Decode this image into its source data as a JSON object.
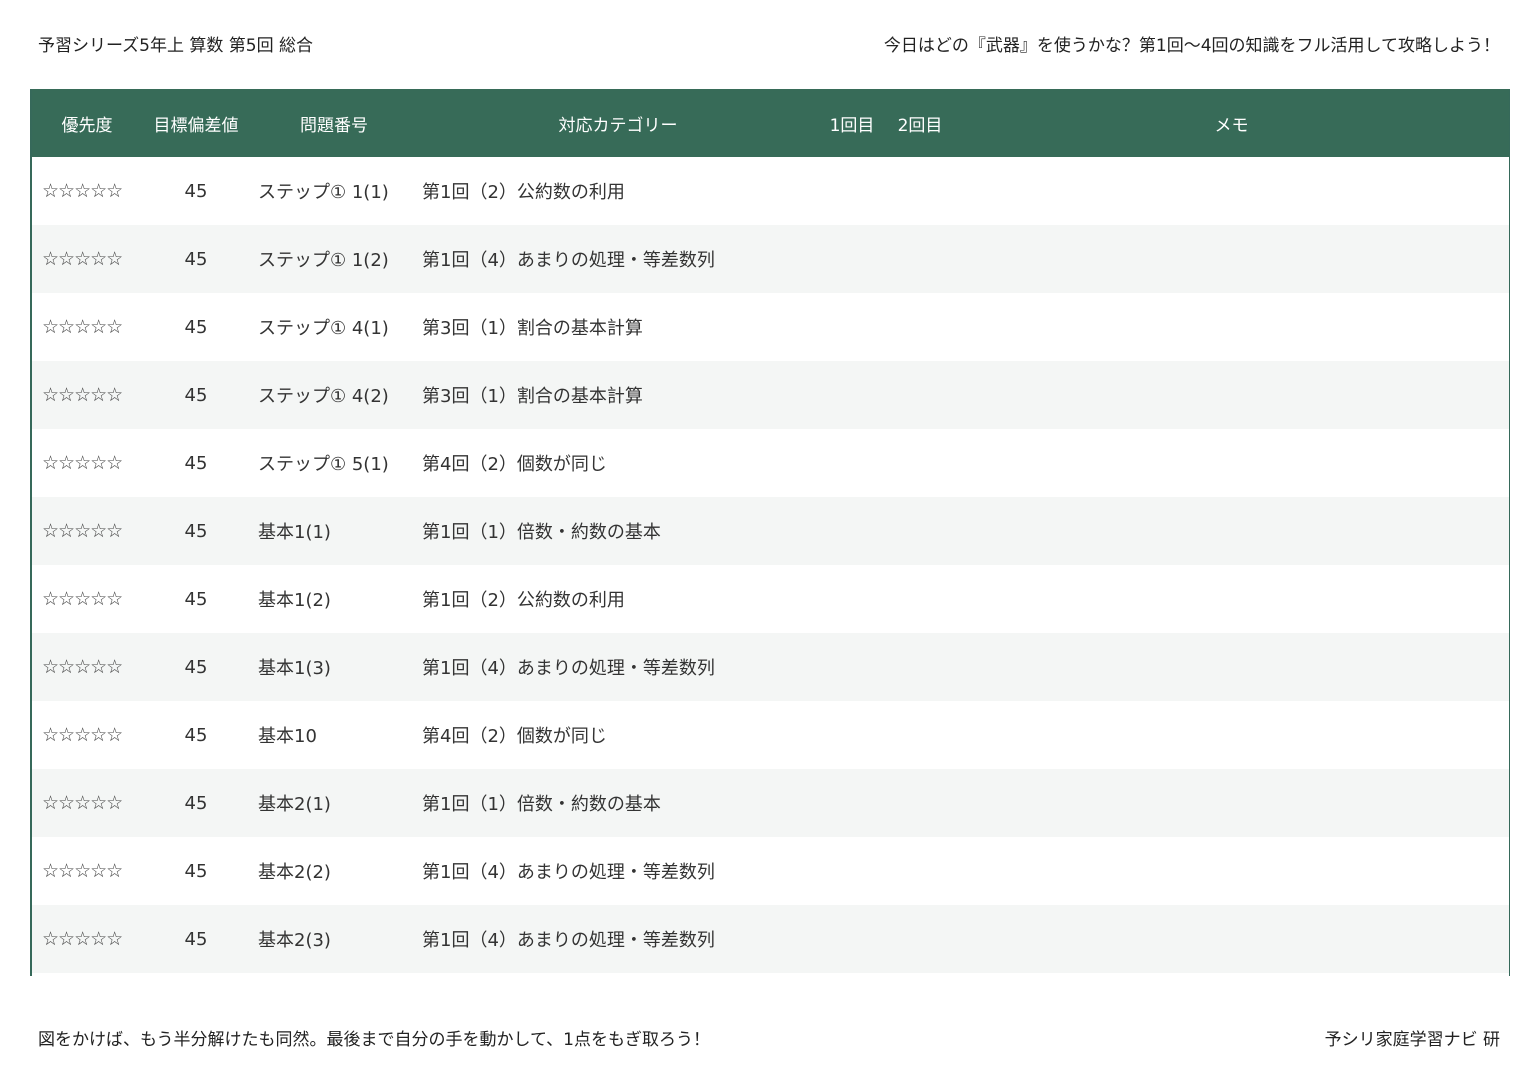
{
  "header": {
    "title": "予習シリーズ5年上 算数 第5回 総合",
    "tagline": "今日はどの『武器』を使うかな？第1回〜4回の知識をフル活用して攻略しよう！"
  },
  "table": {
    "columns": {
      "priority": "優先度",
      "target": "目標偏差値",
      "number": "問題番号",
      "category": "対応カテゴリー",
      "round1": "1回目",
      "round2": "2回目",
      "memo": "メモ"
    },
    "rows": [
      {
        "priority": "☆☆☆☆☆",
        "target": "45",
        "number": "ステップ① 1(1)",
        "category": "第1回（2）公約数の利用",
        "round1": "",
        "round2": "",
        "memo": ""
      },
      {
        "priority": "☆☆☆☆☆",
        "target": "45",
        "number": "ステップ① 1(2)",
        "category": "第1回（4）あまりの処理・等差数列",
        "round1": "",
        "round2": "",
        "memo": ""
      },
      {
        "priority": "☆☆☆☆☆",
        "target": "45",
        "number": "ステップ① 4(1)",
        "category": "第3回（1）割合の基本計算",
        "round1": "",
        "round2": "",
        "memo": ""
      },
      {
        "priority": "☆☆☆☆☆",
        "target": "45",
        "number": "ステップ① 4(2)",
        "category": "第3回（1）割合の基本計算",
        "round1": "",
        "round2": "",
        "memo": ""
      },
      {
        "priority": "☆☆☆☆☆",
        "target": "45",
        "number": "ステップ① 5(1)",
        "category": "第4回（2）個数が同じ",
        "round1": "",
        "round2": "",
        "memo": ""
      },
      {
        "priority": "☆☆☆☆☆",
        "target": "45",
        "number": "基本1(1)",
        "category": "第1回（1）倍数・約数の基本",
        "round1": "",
        "round2": "",
        "memo": ""
      },
      {
        "priority": "☆☆☆☆☆",
        "target": "45",
        "number": "基本1(2)",
        "category": "第1回（2）公約数の利用",
        "round1": "",
        "round2": "",
        "memo": ""
      },
      {
        "priority": "☆☆☆☆☆",
        "target": "45",
        "number": "基本1(3)",
        "category": "第1回（4）あまりの処理・等差数列",
        "round1": "",
        "round2": "",
        "memo": ""
      },
      {
        "priority": "☆☆☆☆☆",
        "target": "45",
        "number": "基本10",
        "category": "第4回（2）個数が同じ",
        "round1": "",
        "round2": "",
        "memo": ""
      },
      {
        "priority": "☆☆☆☆☆",
        "target": "45",
        "number": "基本2(1)",
        "category": "第1回（1）倍数・約数の基本",
        "round1": "",
        "round2": "",
        "memo": ""
      },
      {
        "priority": "☆☆☆☆☆",
        "target": "45",
        "number": "基本2(2)",
        "category": "第1回（4）あまりの処理・等差数列",
        "round1": "",
        "round2": "",
        "memo": ""
      },
      {
        "priority": "☆☆☆☆☆",
        "target": "45",
        "number": "基本2(3)",
        "category": "第1回（4）あまりの処理・等差数列",
        "round1": "",
        "round2": "",
        "memo": ""
      }
    ]
  },
  "footer": {
    "message": "図をかけば、もう半分解けたも同然。最後まで自分の手を動かして、1点をもぎ取ろう！",
    "credit": "予シリ家庭学習ナビ 研"
  },
  "colors": {
    "header_bg": "#376b58",
    "header_text": "#ffffff",
    "stripe_bg": "#f4f6f5"
  }
}
